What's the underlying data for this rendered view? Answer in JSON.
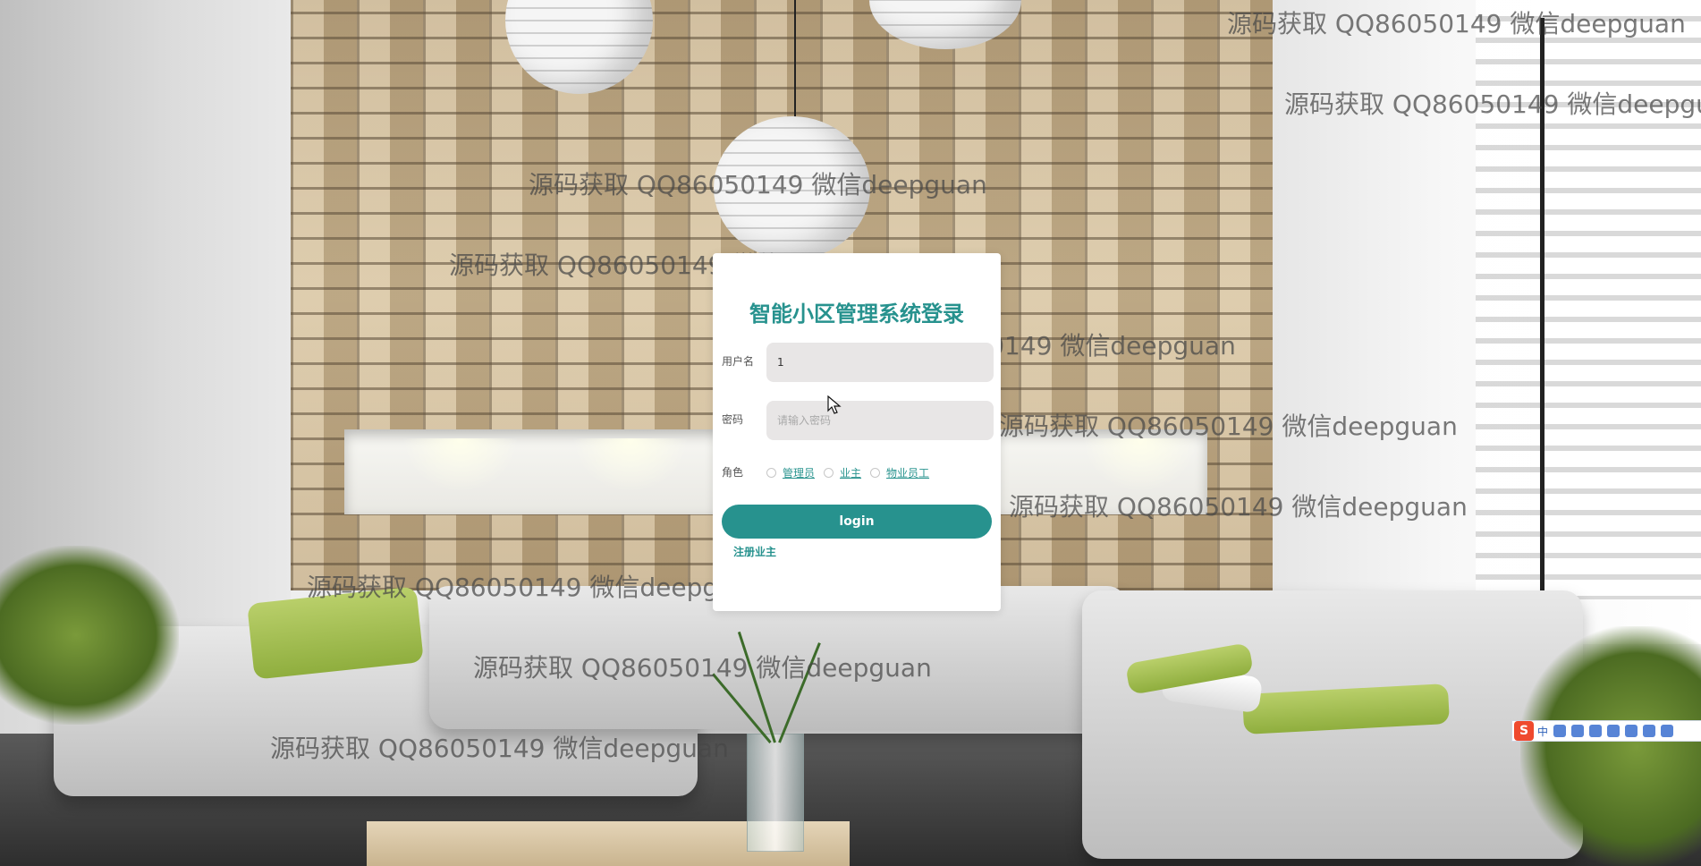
{
  "login": {
    "title": "智能小区管理系统登录",
    "username_label": "用户名",
    "username_value": "1",
    "password_label": "密码",
    "password_placeholder": "请输入密码",
    "role_label": "角色",
    "roles": [
      "管理员",
      "业主",
      "物业员工"
    ],
    "login_button": "login",
    "register_link": "注册业主"
  },
  "watermark": "源码获取 QQ86050149 微信deepguan",
  "ime_toolbar": {
    "logo": "S",
    "lang": "中",
    "icons": [
      "punctuation-icon",
      "emoji-icon",
      "microphone-icon",
      "keyboard-icon",
      "user-icon",
      "skin-icon",
      "settings-icon"
    ]
  },
  "colors": {
    "accent": "#27928e",
    "card_bg": "#ffffff",
    "field_bg": "#e8e6e6"
  }
}
